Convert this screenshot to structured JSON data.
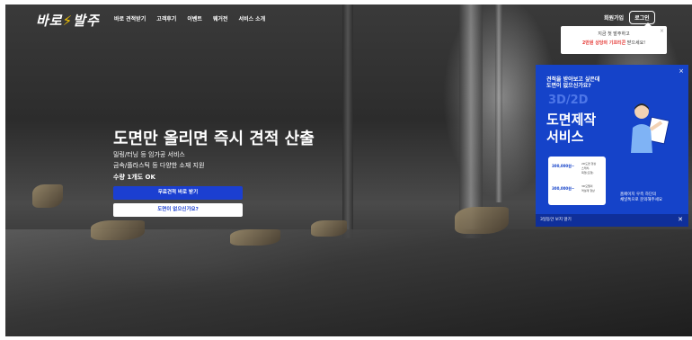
{
  "header": {
    "logo": "바로",
    "logo_suffix": "발주",
    "nav": [
      "바로 견적받기",
      "고객후기",
      "이벤트",
      "웨거전",
      "서비스 소개"
    ],
    "signup": "회원가입",
    "login": "로그인"
  },
  "tooltip": {
    "line1": "지금 첫 발주하고",
    "highlight": "2만원 상당의 기프티콘",
    "line2_suffix": " 받으세요!",
    "close": "×"
  },
  "hero": {
    "title": "도면만 올리면 즉시 견적 산출",
    "line1": "밀링/터닝 등 임가공 서비스",
    "line2": "금속/플라스틱 등 다양한 소재 지원",
    "line3": "수량 1개도 OK",
    "cta_primary": "무료견적 바로 받기",
    "cta_secondary": "도면이 없으신가요?"
  },
  "ad": {
    "question_line1": "견적을 받아보고 싶은데",
    "question_line2": "도면이 없으신가요?",
    "ghost": "3D/2D",
    "heading1": "도면제작",
    "heading2": "서비스",
    "price1": "300,000원~",
    "desc1a": "2D도면 형상",
    "desc1b": "스케치,",
    "desc1c": "목업(모형)",
    "price2": "300,000원~",
    "desc2a": "3D모델의",
    "desc2b": "역설계 형상",
    "note_line1": "홈페이지 우측 하단의",
    "note_line2": "채널톡으로 문의해주세요",
    "footer": "3일동안 보지 않기",
    "close": "×",
    "footer_close": "✕"
  },
  "colors": {
    "primary": "#1b3fd1",
    "ad_bg": "#1543c9",
    "accent_red": "#e53935",
    "bolt": "#f4c400"
  }
}
